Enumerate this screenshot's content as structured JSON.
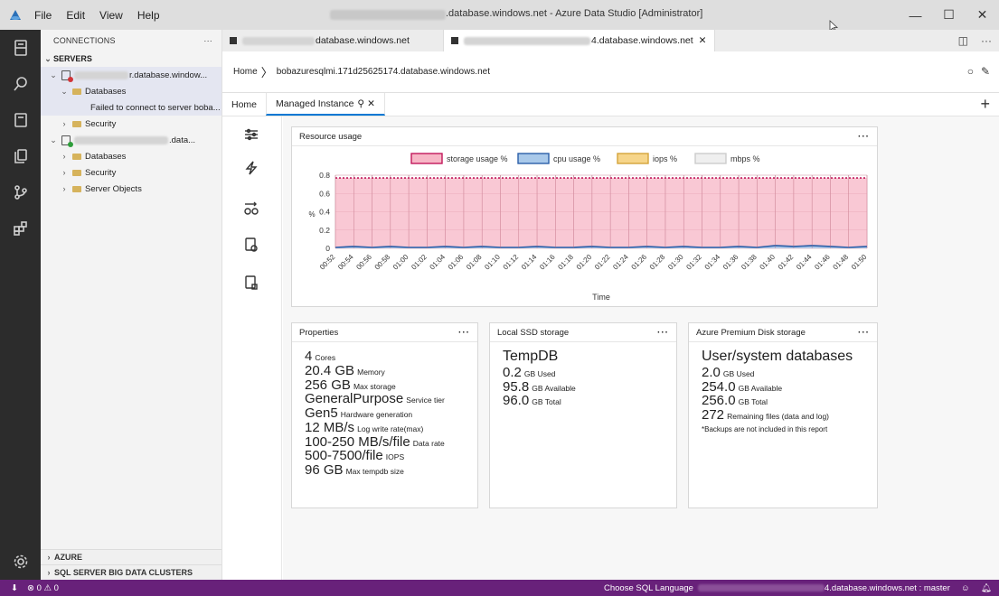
{
  "titlebar": {
    "menu": [
      "File",
      "Edit",
      "View",
      "Help"
    ],
    "title_suffix": ".database.windows.net - Azure Data Studio [Administrator]",
    "window_buttons": [
      "—",
      "☐",
      "✕"
    ]
  },
  "sidebar": {
    "header": "CONNECTIONS",
    "more": "···",
    "servers_label": "SERVERS",
    "server1_name": "r.database.window...",
    "server1_databases": "Databases",
    "server1_error": "Failed to connect to server boba...",
    "server1_security": "Security",
    "server2_name": ".data...",
    "server2_databases": "Databases",
    "server2_security": "Security",
    "server2_objects": "Server Objects",
    "azure": "AZURE",
    "bigdata": "SQL SERVER BIG DATA CLUSTERS"
  },
  "tabs": [
    {
      "label": "database.windows.net"
    },
    {
      "label": "4.database.windows.net",
      "close": "✕"
    }
  ],
  "breadcrumb": {
    "home": "Home",
    "sep": "〉",
    "server": "bobazuresqlmi.171d25625174.database.windows.net"
  },
  "dashboard_tabs": {
    "home": "Home",
    "active": "Managed Instance",
    "pin": "⚲",
    "close": "✕",
    "plus": "+"
  },
  "widgets": {
    "resource": {
      "title": "Resource usage",
      "more": "···"
    },
    "properties": {
      "title": "Properties",
      "more": "···",
      "rows": [
        {
          "value": "4",
          "label": "Cores"
        },
        {
          "value": "20.4 GB",
          "label": "Memory"
        },
        {
          "value": "256 GB",
          "label": "Max storage"
        },
        {
          "value": "GeneralPurpose",
          "label": "Service tier"
        },
        {
          "value": "Gen5",
          "label": "Hardware generation"
        },
        {
          "value": "12 MB/s",
          "label": "Log write rate(max)"
        },
        {
          "value": "100-250 MB/s/file",
          "label": "Data rate"
        },
        {
          "value": "500-7500/file",
          "label": "IOPS"
        },
        {
          "value": "96 GB",
          "label": "Max tempdb size"
        }
      ]
    },
    "local_ssd": {
      "title": "Local SSD storage",
      "more": "···",
      "heading": "TempDB",
      "rows": [
        {
          "value": "0.2",
          "label": "GB Used"
        },
        {
          "value": "95.8",
          "label": "GB Available"
        },
        {
          "value": "96.0",
          "label": "GB Total"
        }
      ]
    },
    "premium_disk": {
      "title": "Azure Premium Disk storage",
      "more": "···",
      "heading": "User/system databases",
      "rows": [
        {
          "value": "2.0",
          "label": "GB Used"
        },
        {
          "value": "254.0",
          "label": "GB Available"
        },
        {
          "value": "256.0",
          "label": "GB Total"
        },
        {
          "value": "272",
          "label": "Remaining files (data and log)"
        }
      ],
      "note": "*Backups are not included in this report"
    }
  },
  "statusbar": {
    "left": "⊗ 0 ⚠ 0",
    "language": "Choose SQL Language",
    "connection": "4.database.windows.net : master"
  },
  "chart_data": {
    "type": "area",
    "title": "",
    "xlabel": "Time",
    "ylabel": "%",
    "ylim": [
      0,
      0.8
    ],
    "yticks": [
      0,
      0.2,
      0.4,
      0.6,
      0.8
    ],
    "x": [
      "00:52",
      "00:54",
      "00:56",
      "00:58",
      "01:00",
      "01:02",
      "01:04",
      "01:06",
      "01:08",
      "01:10",
      "01:12",
      "01:14",
      "01:16",
      "01:18",
      "01:20",
      "01:22",
      "01:24",
      "01:26",
      "01:28",
      "01:30",
      "01:32",
      "01:34",
      "01:36",
      "01:38",
      "01:40",
      "01:42",
      "01:44",
      "01:46",
      "01:48",
      "01:50"
    ],
    "series": [
      {
        "name": "storage usage %",
        "color": "#f7b6c6",
        "stroke": "#c2185b",
        "values": [
          0.77,
          0.77,
          0.77,
          0.77,
          0.77,
          0.77,
          0.77,
          0.77,
          0.77,
          0.77,
          0.77,
          0.77,
          0.77,
          0.77,
          0.77,
          0.77,
          0.77,
          0.77,
          0.77,
          0.77,
          0.77,
          0.77,
          0.77,
          0.77,
          0.77,
          0.77,
          0.77,
          0.77,
          0.77,
          0.77
        ]
      },
      {
        "name": "cpu usage %",
        "color": "#a9c9ea",
        "stroke": "#2b5fa8",
        "values": [
          0.01,
          0.02,
          0.01,
          0.02,
          0.01,
          0.01,
          0.02,
          0.01,
          0.02,
          0.01,
          0.01,
          0.02,
          0.01,
          0.01,
          0.02,
          0.01,
          0.01,
          0.02,
          0.01,
          0.02,
          0.01,
          0.01,
          0.02,
          0.01,
          0.03,
          0.02,
          0.03,
          0.02,
          0.01,
          0.02
        ]
      },
      {
        "name": "iops %",
        "color": "#f6d58a",
        "stroke": "#d4a43a",
        "values": []
      },
      {
        "name": "mbps %",
        "color": "#efefef",
        "stroke": "#cccccc",
        "values": []
      }
    ]
  }
}
